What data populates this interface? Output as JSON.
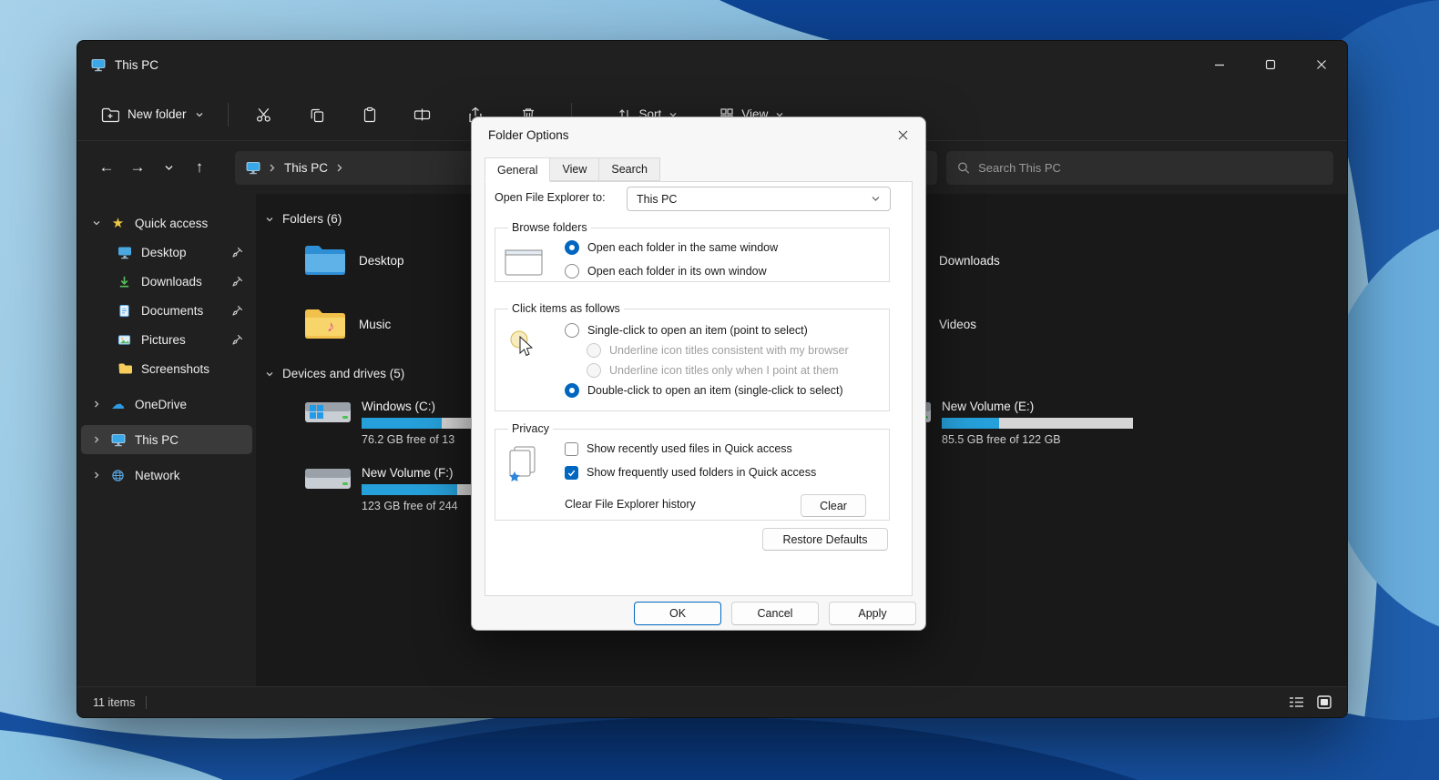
{
  "colors": {
    "accent": "#0067c0",
    "progress_fill": "#26a0da"
  },
  "icons": {
    "quick_access_star": "★",
    "onedrive_cloud": "☁",
    "music_note": "♪",
    "back_arrow": "←",
    "forward_arrow": "→",
    "up_arrow": "↑"
  },
  "explorer": {
    "window_title": "This PC",
    "toolbar": {
      "new_folder": "New folder",
      "sort": "Sort",
      "view": "View"
    },
    "navbar": {
      "breadcrumb_root": "This PC",
      "search_placeholder": "Search This PC"
    },
    "sidebar": {
      "quick_access": "Quick access",
      "items": [
        {
          "label": "Desktop",
          "pinned": true
        },
        {
          "label": "Downloads",
          "pinned": true
        },
        {
          "label": "Documents",
          "pinned": true
        },
        {
          "label": "Pictures",
          "pinned": true
        },
        {
          "label": "Screenshots",
          "pinned": false
        }
      ],
      "onedrive": "OneDrive",
      "this_pc": "This PC",
      "network": "Network"
    },
    "content": {
      "folders_header": "Folders (6)",
      "folders": [
        {
          "name": "Desktop"
        },
        {
          "name": "Music"
        },
        {
          "name": "Downloads"
        },
        {
          "name": "Videos"
        }
      ],
      "devices_header": "Devices and drives (5)",
      "drives": [
        {
          "name": "Windows (C:)",
          "free": "76.2 GB free of 13",
          "used_pct": 42
        },
        {
          "name": "New Volume (F:)",
          "free": "123 GB free of 244",
          "used_pct": 50
        },
        {
          "name": "New Volume (E:)",
          "free": "85.5 GB free of 122 GB",
          "used_pct": 30
        }
      ]
    },
    "statusbar": {
      "item_count": "11 items"
    }
  },
  "dialog": {
    "title": "Folder Options",
    "tabs": [
      {
        "label": "General"
      },
      {
        "label": "View"
      },
      {
        "label": "Search"
      }
    ],
    "open_to_label": "Open File Explorer to:",
    "open_to_value": "This PC",
    "browse": {
      "legend": "Browse folders",
      "same_window": "Open each folder in the same window",
      "own_window": "Open each folder in its own window"
    },
    "click": {
      "legend": "Click items as follows",
      "single": "Single-click to open an item (point to select)",
      "underline_browser": "Underline icon titles consistent with my browser",
      "underline_point": "Underline icon titles only when I point at them",
      "double": "Double-click to open an item (single-click to select)"
    },
    "privacy": {
      "legend": "Privacy",
      "recent": "Show recently used files in Quick access",
      "frequent": "Show frequently used folders in Quick access",
      "clear_label": "Clear File Explorer history",
      "clear_button": "Clear"
    },
    "restore_defaults": "Restore Defaults",
    "ok": "OK",
    "cancel": "Cancel",
    "apply": "Apply"
  }
}
